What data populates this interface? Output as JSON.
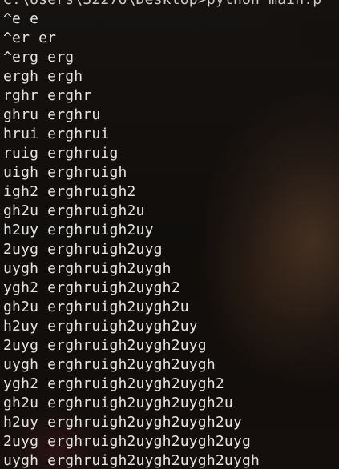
{
  "terminal": {
    "prompt_fragment": "C:\\Users\\32276\\Desktop>python main.p",
    "lines": [
      "^e e",
      "^er er",
      "^erg erg",
      "ergh ergh",
      "rghr erghr",
      "ghru erghru",
      "hrui erghrui",
      "ruig erghruig",
      "uigh erghruigh",
      "igh2 erghruigh2",
      "gh2u erghruigh2u",
      "h2uy erghruigh2uy",
      "2uyg erghruigh2uyg",
      "uygh erghruigh2uygh",
      "ygh2 erghruigh2uygh2",
      "gh2u erghruigh2uygh2u",
      "h2uy erghruigh2uygh2uy",
      "2uyg erghruigh2uygh2uyg",
      "uygh erghruigh2uygh2uygh",
      "ygh2 erghruigh2uygh2uygh2",
      "gh2u erghruigh2uygh2uygh2u",
      "h2uy erghruigh2uygh2uygh2uy",
      "2uyg erghruigh2uygh2uygh2uyg",
      "uygh erghruigh2uygh2uygh2uygh"
    ]
  }
}
